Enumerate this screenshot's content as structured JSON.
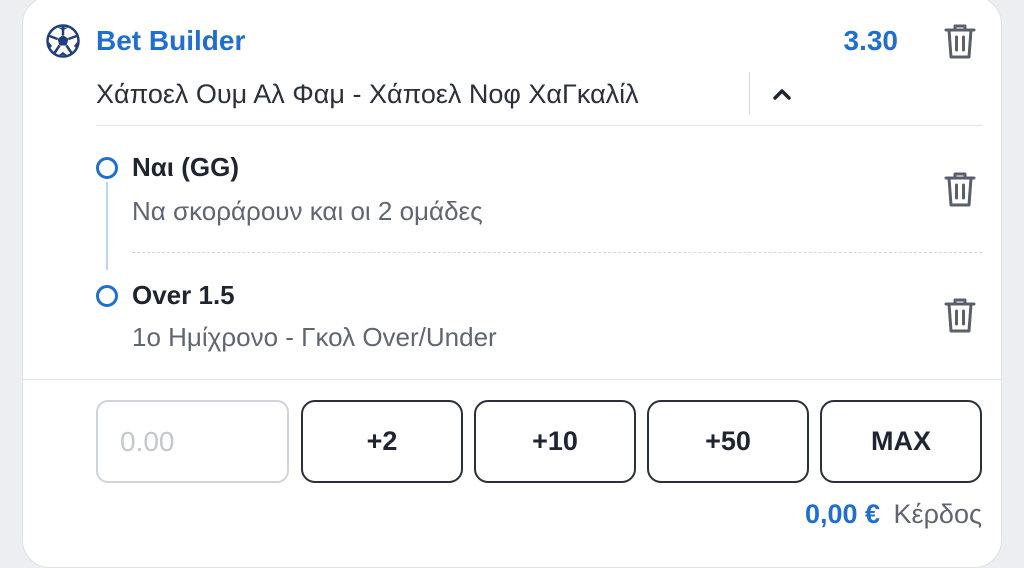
{
  "header": {
    "icon": "soccer-ball-icon",
    "title": "Bet Builder",
    "odds": "3.30"
  },
  "match": {
    "name": "Χάποελ Ουμ Αλ Φαμ - Χάποελ Νοφ ΧαΓκαλίλ",
    "expanded": true
  },
  "selections": [
    {
      "name": "Ναι (GG)",
      "market": "Να σκοράρουν και οι 2 ομάδες"
    },
    {
      "name": "Over 1.5",
      "market": "1ο Ημίχρονο - Γκολ Over/Under"
    }
  ],
  "stake": {
    "value": "",
    "placeholder": "0.00"
  },
  "quick_stakes": [
    "+2",
    "+10",
    "+50",
    "MAX"
  ],
  "profit": {
    "amount": "0,00 €",
    "label": "Κέρδος"
  },
  "colors": {
    "accent": "#1f6fd1",
    "text": "#1e2430",
    "muted": "#5f6672"
  }
}
